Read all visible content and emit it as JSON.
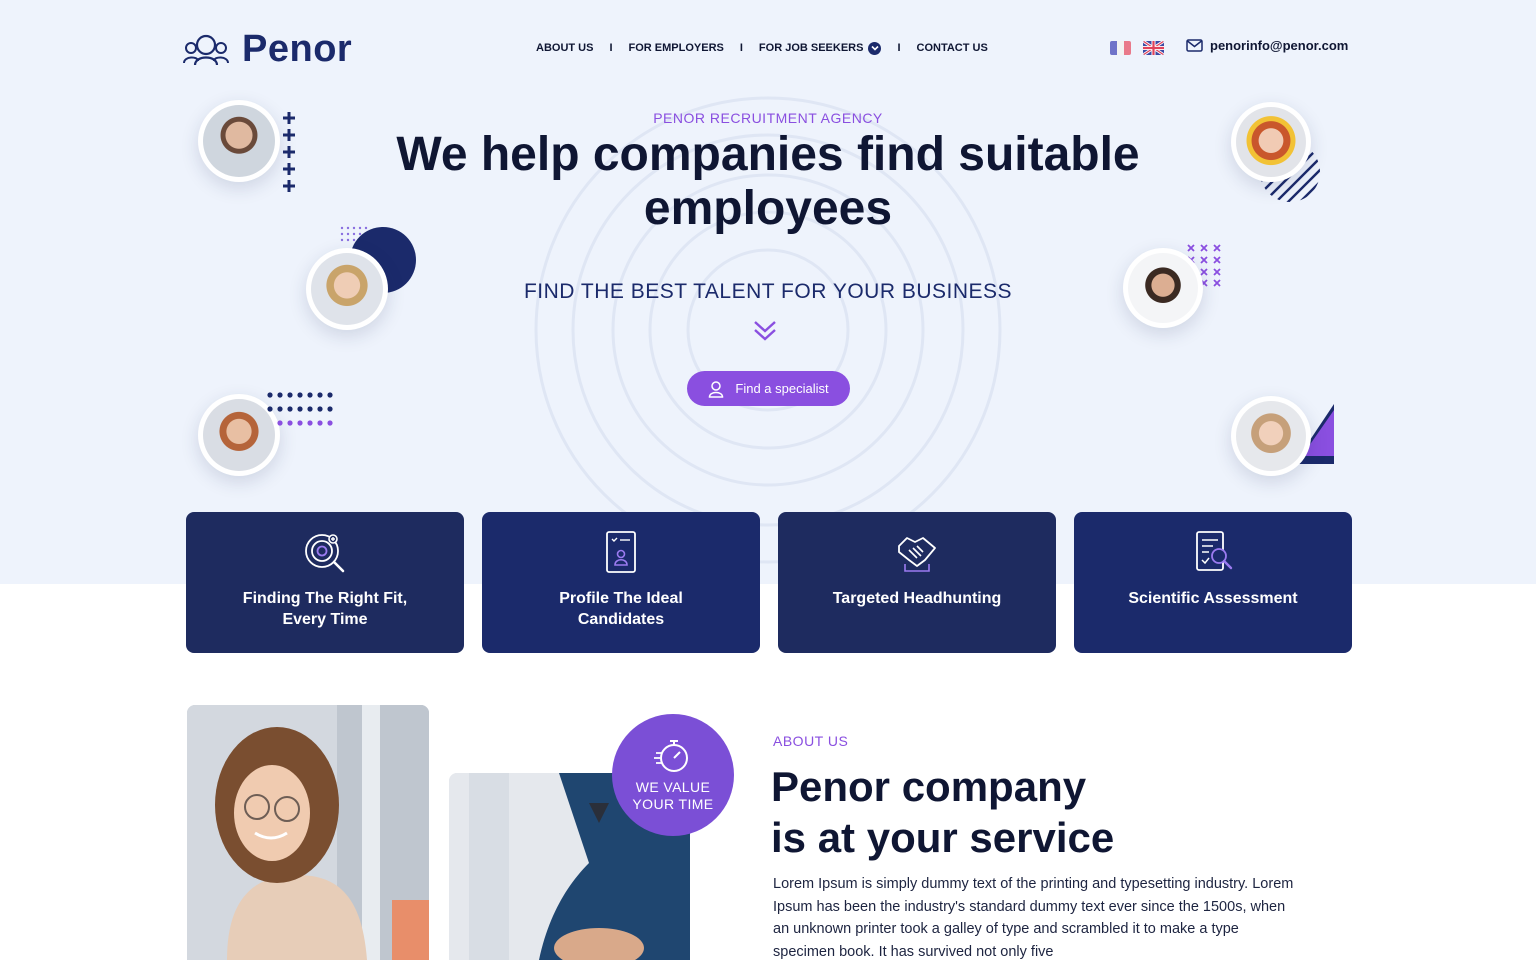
{
  "brand": {
    "name": "Penor",
    "logo_icon": "people-group-icon"
  },
  "nav": {
    "items": [
      {
        "label": "ABOUT US"
      },
      {
        "label": "FOR EMPLOYERS"
      },
      {
        "label": "FOR JOB SEEKERS",
        "has_dropdown": true
      },
      {
        "label": "CONTACT US"
      }
    ],
    "separator": "I"
  },
  "languages": [
    {
      "code": "fr",
      "icon": "flag-france-icon"
    },
    {
      "code": "en",
      "icon": "flag-uk-icon"
    }
  ],
  "contact": {
    "email": "penorinfo@penor.com",
    "icon": "mail-icon"
  },
  "hero": {
    "eyebrow": "PENOR RECRUITMENT AGENCY",
    "title": "We help companies find suitable employees",
    "subtitle": "FIND THE BEST TALENT FOR YOUR BUSINESS",
    "scroll_icon": "double-chevron-down-icon",
    "cta_label": "Find a specialist",
    "cta_icon": "user-icon"
  },
  "services": [
    {
      "label": "Finding The Right Fit, Every Time",
      "icon": "target-search-icon"
    },
    {
      "label": "Profile The Ideal Candidates",
      "icon": "profile-card-icon"
    },
    {
      "label": "Targeted Headhunting",
      "icon": "handshake-icon"
    },
    {
      "label": "Scientific Assessment",
      "icon": "document-search-icon"
    }
  ],
  "about": {
    "eyebrow": "ABOUT US",
    "title_line1": "Penor company",
    "title_line2": "is at your service",
    "badge": "WE VALUE YOUR TIME",
    "badge_icon": "stopwatch-icon",
    "body": "Lorem Ipsum is simply dummy text of the printing and typesetting industry. Lorem Ipsum has been the industry's standard dummy text ever since the 1500s, when an unknown printer took a galley of type and scrambled it to make a type specimen book. It has survived not only five"
  },
  "colors": {
    "navy": "#1b2a6b",
    "purple": "#8a4fe0",
    "hero_bg": "#eef3fc",
    "text_dark": "#0f1633"
  }
}
